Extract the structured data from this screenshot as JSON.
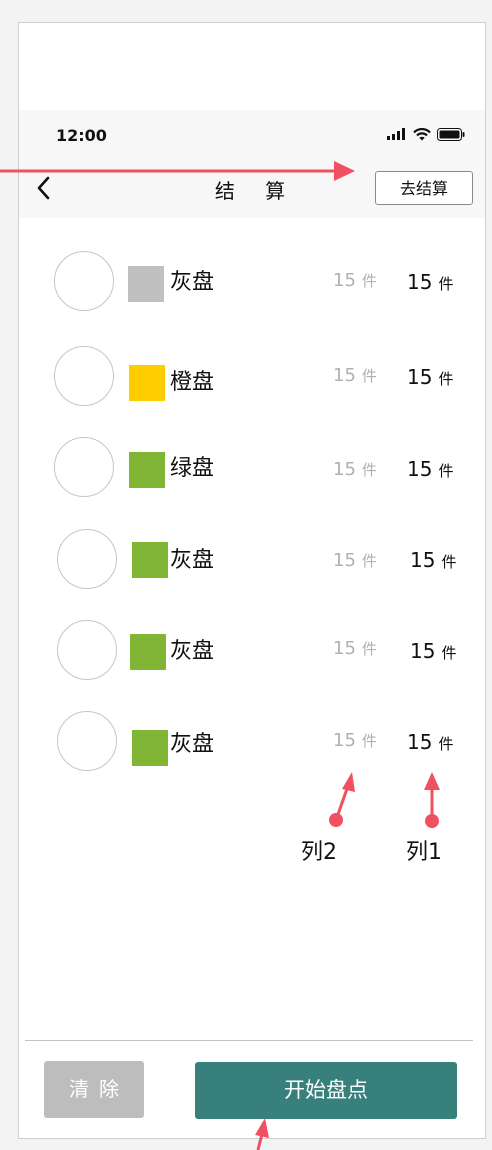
{
  "statusbar": {
    "time": "12:00"
  },
  "navbar": {
    "title": "结 算",
    "action_label": "去结算"
  },
  "items": [
    {
      "name": "灰盘",
      "col2": "15",
      "col2_unit": "件",
      "col1": "15",
      "col1_unit": "件",
      "color": "#c0c0c0"
    },
    {
      "name": "橙盘",
      "col2": "15",
      "col2_unit": "件",
      "col1": "15",
      "col1_unit": "件",
      "color": "#ffcc00"
    },
    {
      "name": "绿盘",
      "col2": "15",
      "col2_unit": "件",
      "col1": "15",
      "col1_unit": "件",
      "color": "#80b536"
    },
    {
      "name": "灰盘",
      "col2": "15",
      "col2_unit": "件",
      "col1": "15",
      "col1_unit": "件",
      "color": "#80b536"
    },
    {
      "name": "灰盘",
      "col2": "15",
      "col2_unit": "件",
      "col1": "15",
      "col1_unit": "件",
      "color": "#80b536"
    },
    {
      "name": "灰盘",
      "col2": "15",
      "col2_unit": "件",
      "col1": "15",
      "col1_unit": "件",
      "color": "#80b536"
    }
  ],
  "annotations": {
    "col2_label": "列2",
    "col1_label": "列1"
  },
  "footer": {
    "clear_label": "清除",
    "start_label": "开始盘点"
  },
  "colors": {
    "annotation_red": "#f05060",
    "primary_teal": "#38807c",
    "disabled_gray": "#bdbdbd"
  }
}
